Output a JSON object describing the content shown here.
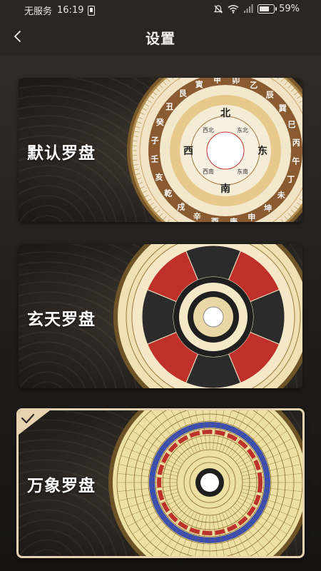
{
  "status": {
    "carrier": "无服务",
    "time": "16:19",
    "battery": "59%",
    "battery_level": 0.59
  },
  "header": {
    "title": "设置"
  },
  "options": [
    {
      "label": "默认罗盘",
      "selected": false
    },
    {
      "label": "玄天罗盘",
      "selected": false
    },
    {
      "label": "万象罗盘",
      "selected": true
    }
  ],
  "compass_text": {
    "default_inner": [
      "北",
      "东",
      "南",
      "西"
    ],
    "default_inner_small": [
      "东北",
      "东南",
      "西南",
      "西北"
    ],
    "default_ring": [
      "丑",
      "艮",
      "寅",
      "甲",
      "卯",
      "乙",
      "辰",
      "巽",
      "巳",
      "丙",
      "午",
      "丁",
      "未",
      "坤",
      "申",
      "庚",
      "酉",
      "辛",
      "戌",
      "乾",
      "亥",
      "壬",
      "子",
      "癸"
    ]
  },
  "colors": {
    "accent_border": "#e8d3b0",
    "background": "#2a2723"
  }
}
